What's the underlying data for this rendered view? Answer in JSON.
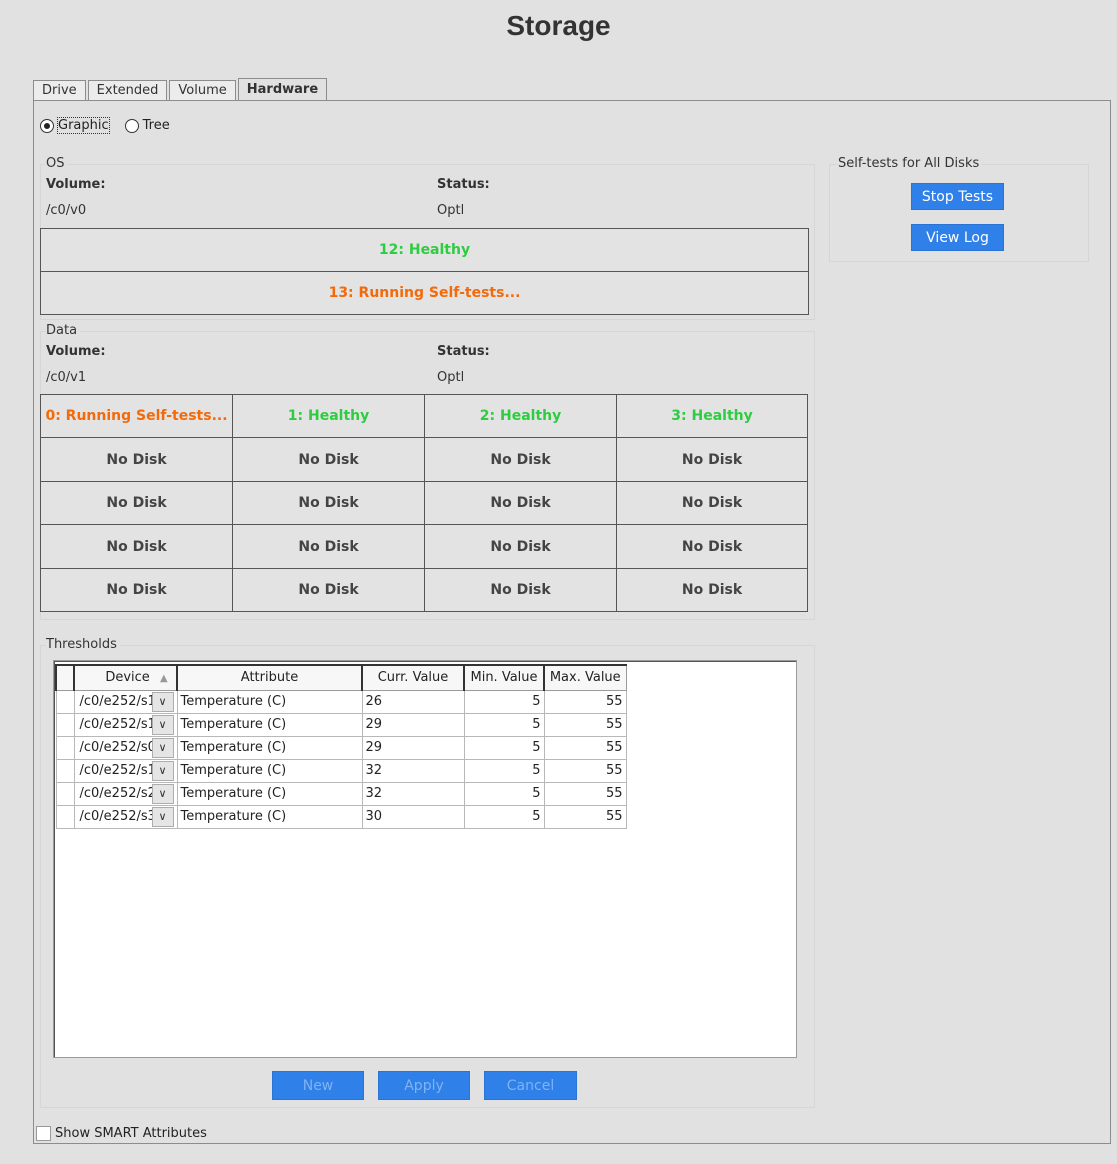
{
  "window": {
    "title": "Storage"
  },
  "tabs": [
    {
      "label": "Drive",
      "active": false
    },
    {
      "label": "Extended",
      "active": false
    },
    {
      "label": "Volume",
      "active": false
    },
    {
      "label": "Hardware",
      "active": true
    }
  ],
  "view_mode": {
    "options": [
      {
        "label": "Graphic",
        "selected": true
      },
      {
        "label": "Tree",
        "selected": false
      }
    ]
  },
  "os_group": {
    "label": "OS",
    "volume_header": "Volume:",
    "status_header": "Status:",
    "volume": "/c0/v0",
    "status": "Optl",
    "slots": [
      {
        "text": "12: Healthy",
        "state": "healthy"
      },
      {
        "text": "13: Running Self-tests...",
        "state": "running"
      }
    ]
  },
  "data_group": {
    "label": "Data",
    "volume_header": "Volume:",
    "status_header": "Status:",
    "volume": "/c0/v1",
    "status": "Optl",
    "slot_rows": [
      [
        {
          "text": "0: Running Self-tests...",
          "state": "running"
        },
        {
          "text": "1: Healthy",
          "state": "healthy"
        },
        {
          "text": "2: Healthy",
          "state": "healthy"
        },
        {
          "text": "3: Healthy",
          "state": "healthy"
        }
      ],
      [
        {
          "text": "No Disk",
          "state": "empty"
        },
        {
          "text": "No Disk",
          "state": "empty"
        },
        {
          "text": "No Disk",
          "state": "empty"
        },
        {
          "text": "No Disk",
          "state": "empty"
        }
      ],
      [
        {
          "text": "No Disk",
          "state": "empty"
        },
        {
          "text": "No Disk",
          "state": "empty"
        },
        {
          "text": "No Disk",
          "state": "empty"
        },
        {
          "text": "No Disk",
          "state": "empty"
        }
      ],
      [
        {
          "text": "No Disk",
          "state": "empty"
        },
        {
          "text": "No Disk",
          "state": "empty"
        },
        {
          "text": "No Disk",
          "state": "empty"
        },
        {
          "text": "No Disk",
          "state": "empty"
        }
      ],
      [
        {
          "text": "No Disk",
          "state": "empty"
        },
        {
          "text": "No Disk",
          "state": "empty"
        },
        {
          "text": "No Disk",
          "state": "empty"
        },
        {
          "text": "No Disk",
          "state": "empty"
        }
      ]
    ]
  },
  "self_tests": {
    "label": "Self-tests for All Disks",
    "stop_label": "Stop Tests",
    "view_log_label": "View Log"
  },
  "thresholds": {
    "label": "Thresholds",
    "columns": [
      "Device",
      "Attribute",
      "Curr. Value",
      "Min. Value",
      "Max. Value"
    ],
    "sort_icon": "sort-ascending-icon",
    "rows": [
      {
        "device": "/c0/e252/s1",
        "attribute": "Temperature (C)",
        "curr": "26",
        "min": "5",
        "max": "55"
      },
      {
        "device": "/c0/e252/s1",
        "attribute": "Temperature (C)",
        "curr": "29",
        "min": "5",
        "max": "55"
      },
      {
        "device": "/c0/e252/s0",
        "attribute": "Temperature (C)",
        "curr": "29",
        "min": "5",
        "max": "55"
      },
      {
        "device": "/c0/e252/s1",
        "attribute": "Temperature (C)",
        "curr": "32",
        "min": "5",
        "max": "55"
      },
      {
        "device": "/c0/e252/s2",
        "attribute": "Temperature (C)",
        "curr": "32",
        "min": "5",
        "max": "55"
      },
      {
        "device": "/c0/e252/s3",
        "attribute": "Temperature (C)",
        "curr": "30",
        "min": "5",
        "max": "55"
      }
    ],
    "new_label": "New",
    "apply_label": "Apply",
    "cancel_label": "Cancel"
  },
  "show_smart": {
    "label": "Show SMART Attributes",
    "checked": false
  },
  "colors": {
    "healthy": "#2ecc40",
    "running": "#f26a0a",
    "button": "#2f80e8"
  }
}
